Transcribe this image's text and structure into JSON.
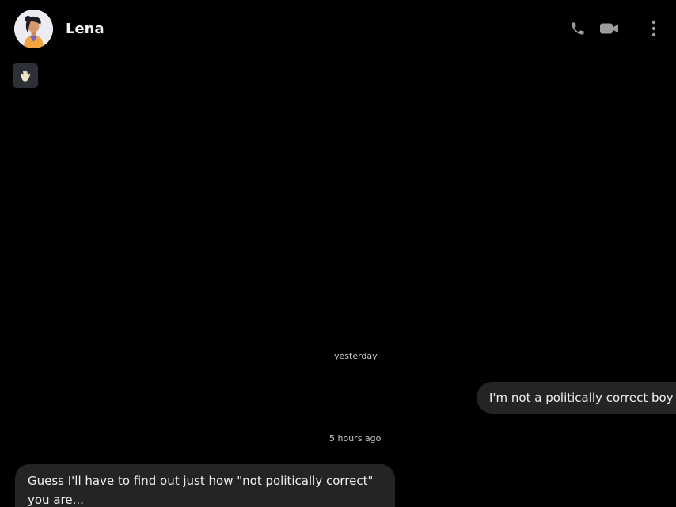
{
  "header": {
    "contact_name": "Lena",
    "avatar_icon": "avatar-woman",
    "actions": [
      {
        "icon": "phone-icon"
      },
      {
        "icon": "video-camera-icon"
      },
      {
        "icon": "more-vertical-icon"
      }
    ]
  },
  "wave_chip": {
    "icon": "waving-hand-icon"
  },
  "conversation": {
    "timestamps": {
      "yesterday": "yesterday",
      "recent": "5 hours ago"
    },
    "messages": [
      {
        "direction": "outgoing",
        "text": "I'm not a politically correct boy"
      },
      {
        "direction": "incoming",
        "text": "Guess I'll have to find out just how \"not politically correct\" you are..."
      }
    ]
  },
  "colors": {
    "background": "#000000",
    "bubble": "#242424",
    "chip": "#2d3036",
    "text": "#f2f2f2",
    "timestamp": "#c9c9c9"
  }
}
